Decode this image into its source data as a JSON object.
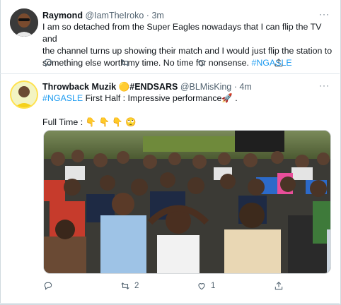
{
  "tweets": [
    {
      "name": "Raymond",
      "handle": "@IamTheIroko",
      "separator": "·",
      "time": "3m",
      "more": "···",
      "line1": "I am so detached from the Super Eagles nowadays that I can flip the TV and",
      "line2": "the channel turns up showing their match and I would just flip the station to",
      "line3": "something else worth my time. No time for nonsense.",
      "hashtag": "#NGASLE",
      "replies": "",
      "retweets": "",
      "likes": ""
    },
    {
      "name": "Throwback Muzik",
      "name_emoji": "🟡",
      "name_tag": "#ENDSARS",
      "handle": "@BLMisKing",
      "separator": "·",
      "time": "4m",
      "more": "···",
      "hashtag": "#NGASLE",
      "line1_rest": " First Half : Impressive performance🚀 .",
      "line2": "Full Time : 👇 👇 👇 🙄",
      "replies": "",
      "retweets": "2",
      "likes": "1"
    }
  ],
  "colors": {
    "accent": "#1d9bf0",
    "muted": "#536471",
    "text": "#0f1419"
  },
  "icons": [
    "reply-icon",
    "retweet-icon",
    "like-icon",
    "share-icon",
    "more-icon"
  ]
}
